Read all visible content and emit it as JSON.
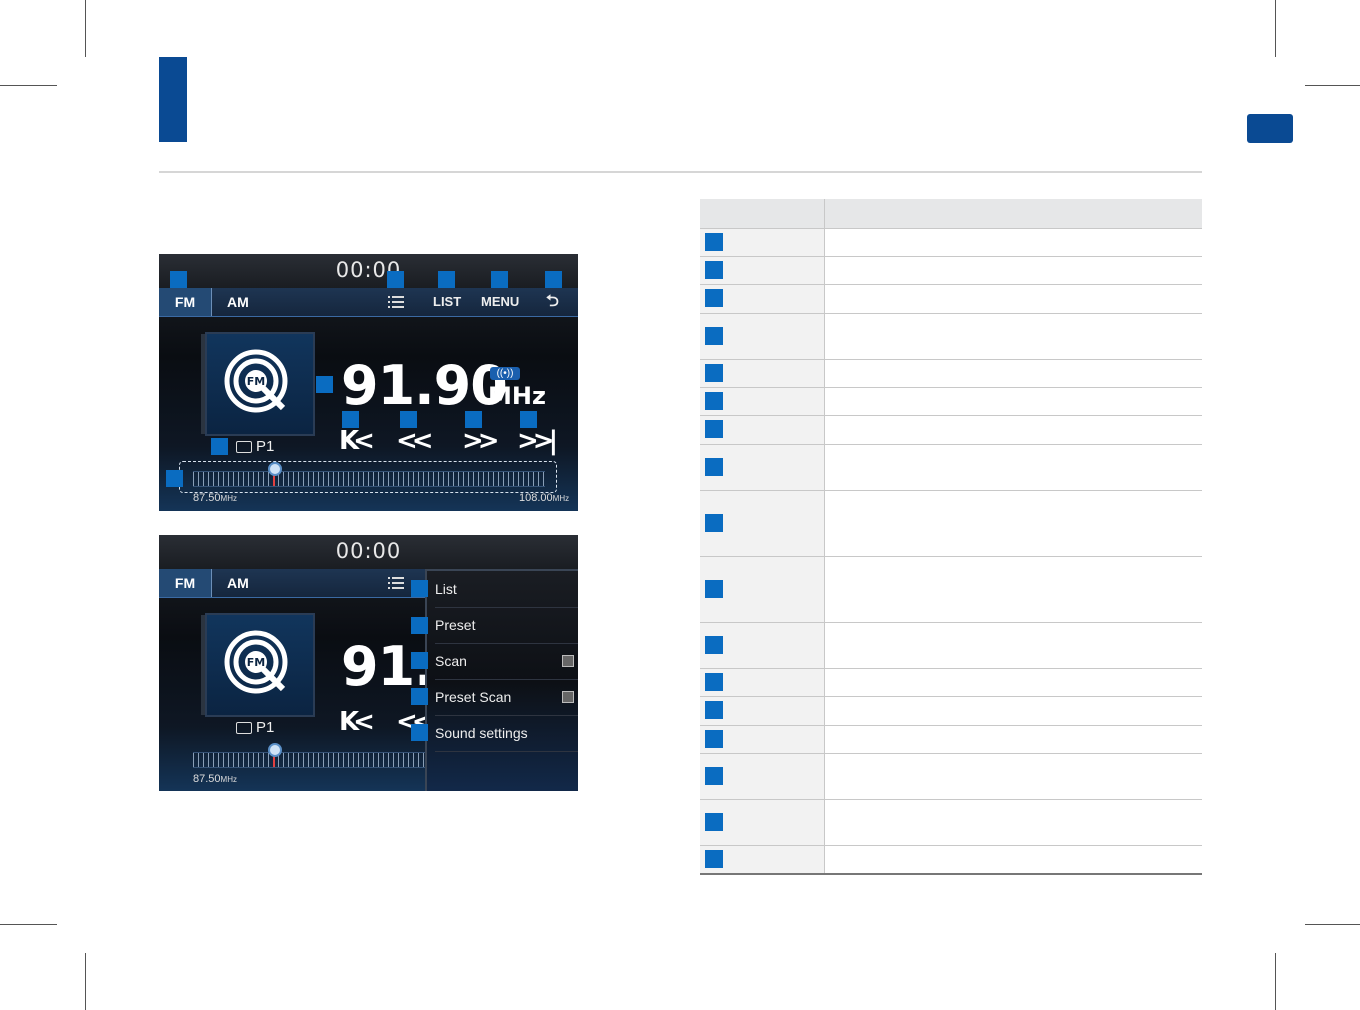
{
  "screen1": {
    "clock": "00:00",
    "tabs": {
      "fm": "FM",
      "am": "AM"
    },
    "toolbar": {
      "list": "LIST",
      "menu": "MENU"
    },
    "art_label": "FM",
    "frequency": "91.90",
    "unit": "MHz",
    "preset": "P1",
    "range_min": "87.50",
    "range_max": "108.00",
    "range_unit": "MHz"
  },
  "screen2": {
    "clock": "00:00",
    "tabs": {
      "fm": "FM",
      "am": "AM"
    },
    "art_label": "FM",
    "frequency_partial": "91.",
    "preset": "P1",
    "range_min": "87.50",
    "range_unit": "MHz",
    "menu": [
      "List",
      "Preset",
      "Scan",
      "Preset Scan",
      "Sound settings"
    ]
  },
  "colors": {
    "accent": "#0a4a93",
    "marker": "#0a6cc1"
  },
  "icons": [
    "list-icon",
    "back-icon",
    "radio-icon",
    "signal-icon",
    "seek-prev-icon",
    "rewind-icon",
    "forward-icon",
    "seek-next-icon"
  ]
}
